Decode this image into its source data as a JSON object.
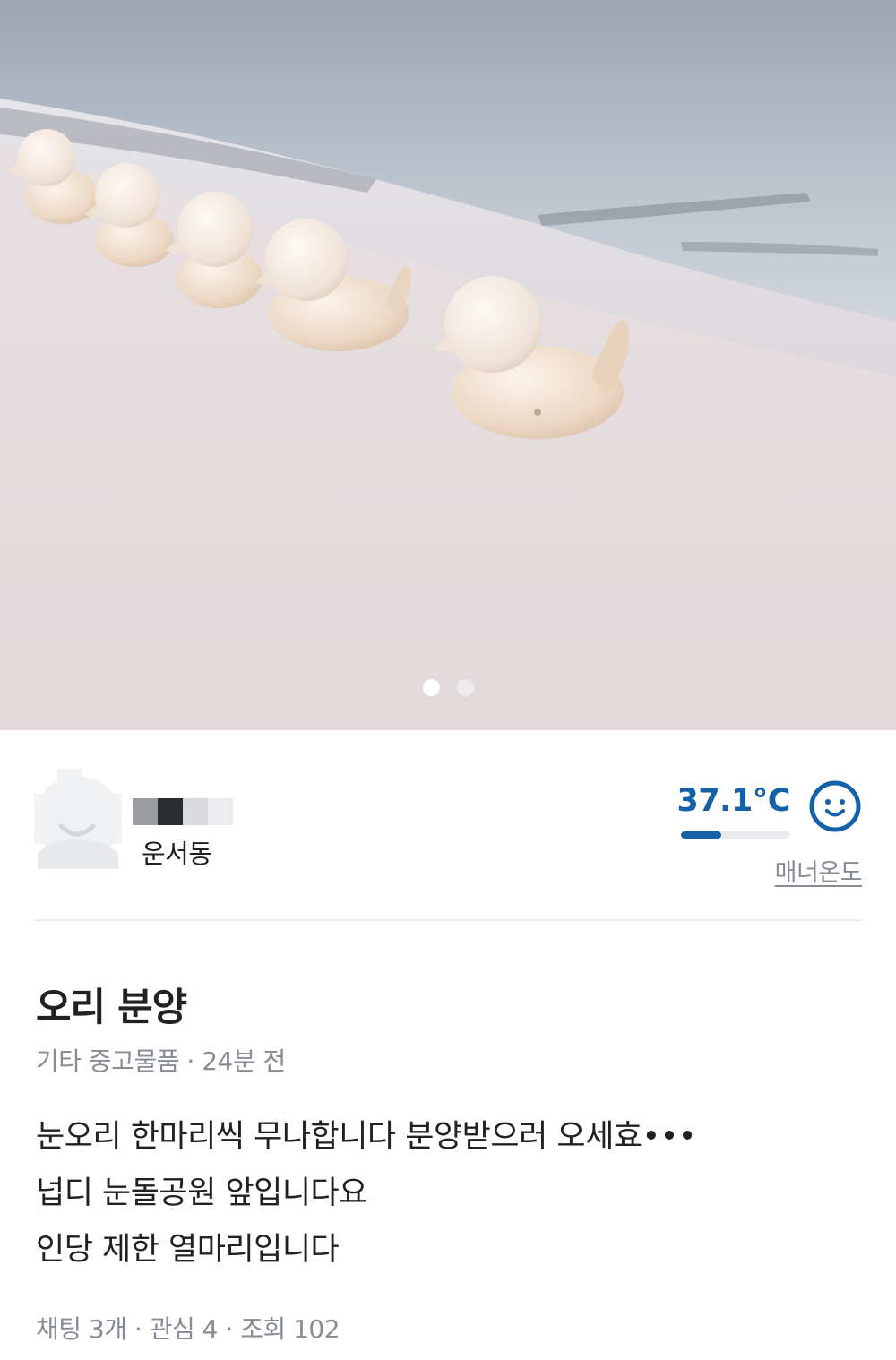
{
  "photo": {
    "alt": "",
    "current_index": 0,
    "dots": [
      "1",
      "2"
    ]
  },
  "seller": {
    "region": "운서동",
    "manner_temperature": "37.1°C",
    "manner_fill_fraction": 0.371,
    "manner_label": "매너온도"
  },
  "article": {
    "title": "오리 분양",
    "category": "기타 중고물품",
    "separator": "·",
    "time_ago": "24분 전",
    "description_lines": [
      "눈오리 한마리씩 무나합니다 분양받으러 오세효•••",
      "넙디 눈돌공원 앞입니다요",
      "인당 제한 열마리입니다"
    ],
    "stats": {
      "chats": "채팅 3개",
      "interest": "관심 4",
      "views": "조회 102"
    }
  },
  "colors": {
    "accent": "#1561a9",
    "text_primary": "#212124",
    "text_secondary": "#868b94",
    "divider": "#eaeef2"
  }
}
